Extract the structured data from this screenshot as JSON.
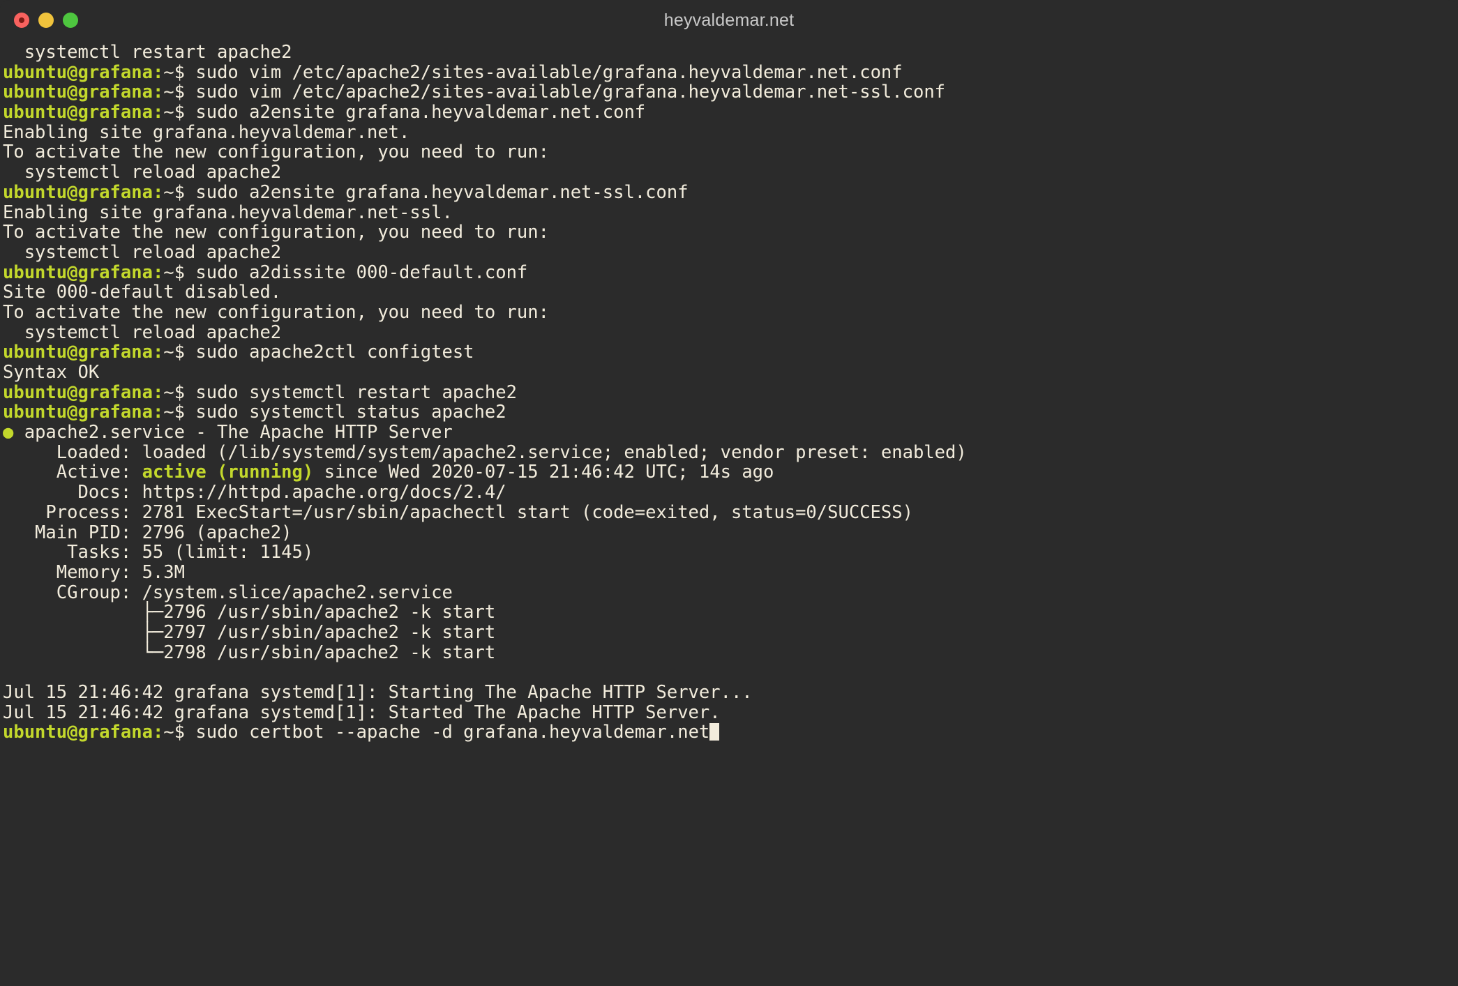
{
  "window": {
    "title": "heyvaldemar.net",
    "traffic_lights": [
      {
        "name": "close-button",
        "color": "#f9625f"
      },
      {
        "name": "minimize-button",
        "color": "#f0c33c"
      },
      {
        "name": "maximize-button",
        "color": "#4ec63f"
      }
    ]
  },
  "theme": {
    "background": "#2b2b2b",
    "foreground": "#f2ecdc",
    "prompt_accent": "#c3d82c",
    "title_color": "#c8c8c8"
  },
  "prompt": {
    "user_host": "ubuntu@grafana",
    "colon": ":",
    "path": "~",
    "sigil": "$"
  },
  "terminal": {
    "lines": [
      {
        "type": "output",
        "text": "  systemctl restart apache2"
      },
      {
        "type": "prompt",
        "command": " sudo vim /etc/apache2/sites-available/grafana.heyvaldemar.net.conf"
      },
      {
        "type": "prompt",
        "command": " sudo vim /etc/apache2/sites-available/grafana.heyvaldemar.net-ssl.conf"
      },
      {
        "type": "prompt",
        "command": " sudo a2ensite grafana.heyvaldemar.net.conf"
      },
      {
        "type": "output",
        "text": "Enabling site grafana.heyvaldemar.net."
      },
      {
        "type": "output",
        "text": "To activate the new configuration, you need to run:"
      },
      {
        "type": "output",
        "text": "  systemctl reload apache2"
      },
      {
        "type": "prompt",
        "command": " sudo a2ensite grafana.heyvaldemar.net-ssl.conf"
      },
      {
        "type": "output",
        "text": "Enabling site grafana.heyvaldemar.net-ssl."
      },
      {
        "type": "output",
        "text": "To activate the new configuration, you need to run:"
      },
      {
        "type": "output",
        "text": "  systemctl reload apache2"
      },
      {
        "type": "prompt",
        "command": " sudo a2dissite 000-default.conf"
      },
      {
        "type": "output",
        "text": "Site 000-default disabled."
      },
      {
        "type": "output",
        "text": "To activate the new configuration, you need to run:"
      },
      {
        "type": "output",
        "text": "  systemctl reload apache2"
      },
      {
        "type": "prompt",
        "command": " sudo apache2ctl configtest"
      },
      {
        "type": "output",
        "text": "Syntax OK"
      },
      {
        "type": "prompt",
        "command": " sudo systemctl restart apache2"
      },
      {
        "type": "prompt",
        "command": " sudo systemctl status apache2"
      },
      {
        "type": "status_head",
        "dot": "●",
        "text": " apache2.service - The Apache HTTP Server"
      },
      {
        "type": "output",
        "text": "     Loaded: loaded (/lib/systemd/system/apache2.service; enabled; vendor preset: enabled)"
      },
      {
        "type": "status_active",
        "prefix": "     Active: ",
        "highlight": "active (running)",
        "suffix": " since Wed 2020-07-15 21:46:42 UTC; 14s ago"
      },
      {
        "type": "output",
        "text": "       Docs: https://httpd.apache.org/docs/2.4/"
      },
      {
        "type": "output",
        "text": "    Process: 2781 ExecStart=/usr/sbin/apachectl start (code=exited, status=0/SUCCESS)"
      },
      {
        "type": "output",
        "text": "   Main PID: 2796 (apache2)"
      },
      {
        "type": "output",
        "text": "      Tasks: 55 (limit: 1145)"
      },
      {
        "type": "output",
        "text": "     Memory: 5.3M"
      },
      {
        "type": "output",
        "text": "     CGroup: /system.slice/apache2.service"
      },
      {
        "type": "output",
        "text": "             ├─2796 /usr/sbin/apache2 -k start"
      },
      {
        "type": "output",
        "text": "             ├─2797 /usr/sbin/apache2 -k start"
      },
      {
        "type": "output",
        "text": "             └─2798 /usr/sbin/apache2 -k start"
      },
      {
        "type": "output",
        "text": ""
      },
      {
        "type": "output",
        "text": "Jul 15 21:46:42 grafana systemd[1]: Starting The Apache HTTP Server..."
      },
      {
        "type": "output",
        "text": "Jul 15 21:46:42 grafana systemd[1]: Started The Apache HTTP Server."
      },
      {
        "type": "prompt_cursor",
        "command": " sudo certbot --apache -d grafana.heyvaldemar.net"
      }
    ]
  }
}
